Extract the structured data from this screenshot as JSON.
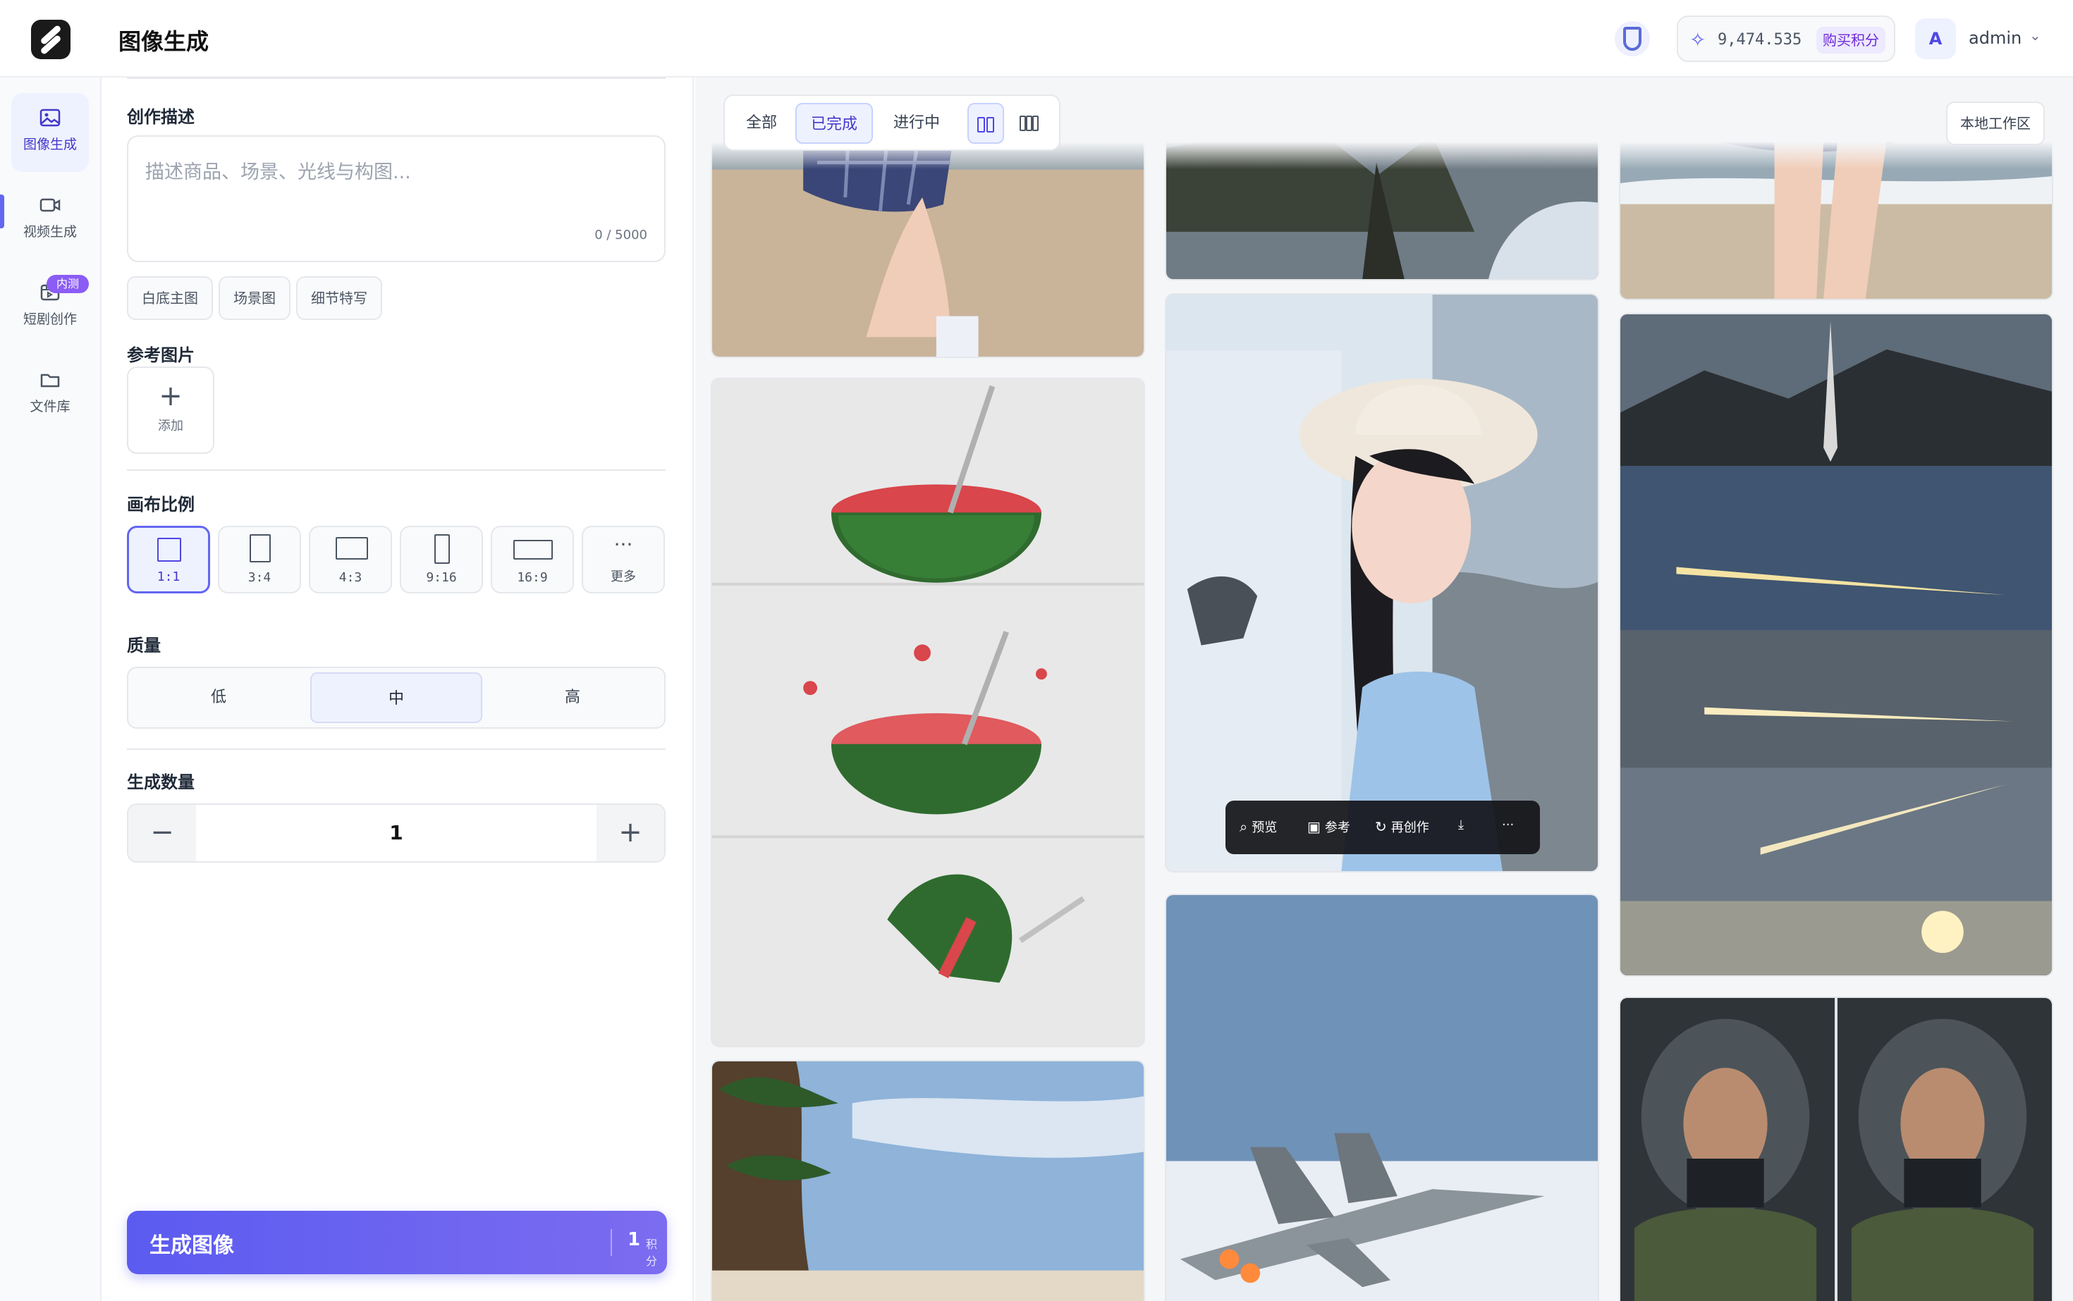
{
  "app": {
    "title": "图像生成"
  },
  "header": {
    "credits_value": "9,474.535",
    "buy_label": "购买积分",
    "user_initial": "A",
    "user_name": "admin"
  },
  "nav": {
    "items": [
      {
        "label": "图像生成",
        "icon": "image-icon"
      },
      {
        "label": "视频生成",
        "icon": "video-icon"
      },
      {
        "label": "短剧创作",
        "icon": "film-icon",
        "badge": "内测"
      },
      {
        "label": "文件库",
        "icon": "folder-icon"
      }
    ]
  },
  "panel": {
    "prompt_label": "创作描述",
    "prompt_placeholder": "描述商品、场景、光线与构图...",
    "prompt_counter": "0 / 5000",
    "chips": [
      "白底主图",
      "场景图",
      "细节特写"
    ],
    "reference_label": "参考图片",
    "add_label": "添加",
    "ratio_label": "画布比例",
    "ratios": [
      "1:1",
      "3:4",
      "4:3",
      "9:16",
      "16:9"
    ],
    "ratio_more": "更多",
    "quality_label": "质量",
    "quality_options": [
      "低",
      "中",
      "高"
    ],
    "quantity_label": "生成数量",
    "quantity_value": "1",
    "generate_label": "生成图像",
    "generate_cost": "1",
    "generate_unit": "积分"
  },
  "gallery": {
    "filters": [
      "全部",
      "已完成",
      "进行中"
    ],
    "selected_filter": "已完成",
    "local_workspace": "本地工作区",
    "hover_actions": [
      "预览",
      "参考",
      "再创作"
    ]
  },
  "colors": {
    "accent": "#6366f1",
    "accent_soft": "#eef2ff"
  }
}
